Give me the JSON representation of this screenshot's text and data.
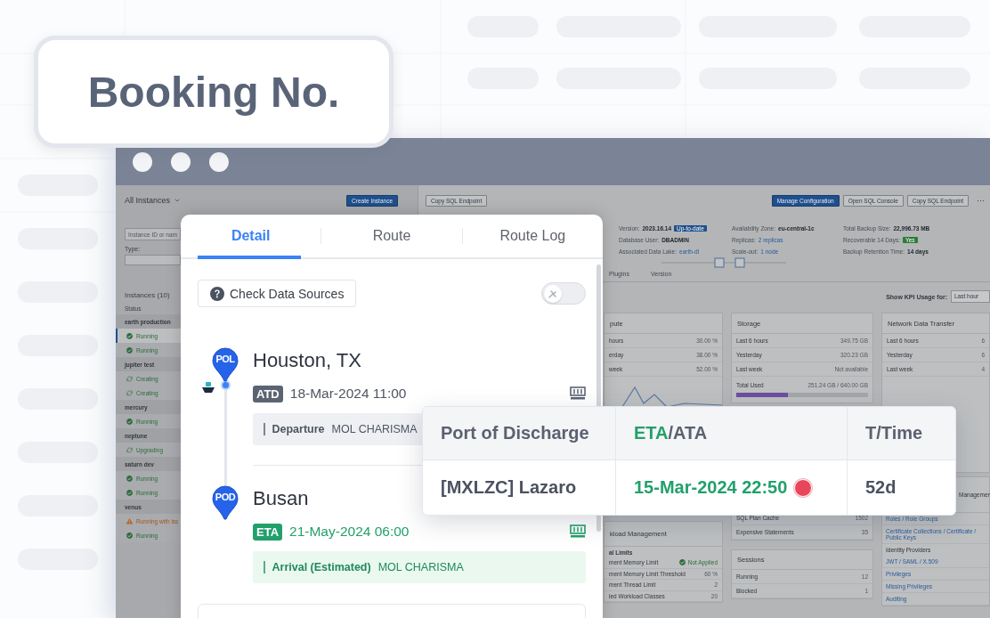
{
  "booking_card": {
    "title": "Booking No."
  },
  "window": {
    "sidebar": {
      "title": "All Instances",
      "create_button": "Create Instance",
      "search_placeholder": "Instance ID or nam",
      "type_label": "Type:",
      "list_title": "Instances (10)",
      "status_label": "Status",
      "groups": [
        {
          "name": "earth production",
          "instances": [
            {
              "status": "Running",
              "kind": "ok",
              "selected": true
            },
            {
              "status": "Running",
              "kind": "ok",
              "selected": false
            }
          ]
        },
        {
          "name": "jupiter test",
          "instances": [
            {
              "status": "Creating",
              "kind": "progress",
              "selected": false
            },
            {
              "status": "Creating",
              "kind": "progress",
              "selected": false
            }
          ]
        },
        {
          "name": "mercury",
          "instances": [
            {
              "status": "Running",
              "kind": "ok",
              "selected": false
            }
          ]
        },
        {
          "name": "neptune",
          "instances": [
            {
              "status": "Upgrading",
              "kind": "progress",
              "selected": false
            }
          ]
        },
        {
          "name": "saturn dev",
          "instances": [
            {
              "status": "Running",
              "kind": "ok",
              "selected": false
            },
            {
              "status": "Running",
              "kind": "ok",
              "selected": false
            }
          ]
        },
        {
          "name": "venus",
          "instances": [
            {
              "status": "Running with iss",
              "kind": "warning",
              "selected": false
            },
            {
              "status": "Running",
              "kind": "ok",
              "selected": false
            }
          ]
        }
      ]
    },
    "toolbar": {
      "left_button": "Copy SQL Endpoint",
      "buttons": [
        {
          "label": "Manage Configuration",
          "primary": true
        },
        {
          "label": "Open SQL Console",
          "primary": false
        },
        {
          "label": "Copy SQL Endpoint",
          "primary": false
        }
      ],
      "more": "···"
    },
    "info": [
      [
        {
          "label": "Version:",
          "value": "2023.16.14",
          "kind": "text",
          "badge": {
            "text": "Up-to-date",
            "color": "#1f4f8c"
          }
        },
        {
          "label": "Database User:",
          "value": "DBADMIN",
          "kind": "text"
        },
        {
          "label": "Associated Data Lake:",
          "value": "earth-dl",
          "kind": "link"
        }
      ],
      [
        {
          "label": "Availability Zone:",
          "value": "eu-central-1c",
          "kind": "text"
        },
        {
          "label": "Replicas:",
          "value": "2 replicas",
          "kind": "link"
        },
        {
          "label": "Scale-out:",
          "value": "1 node",
          "kind": "link"
        }
      ],
      [
        {
          "label": "Total Backup Size:",
          "value": "22,996.73 MB",
          "kind": "text"
        },
        {
          "label": "Recoverable 14 Days:",
          "badge": {
            "text": "Yes",
            "color": "#2f7a3a"
          }
        },
        {
          "label": "Backup Retention Time:",
          "value": "14 days",
          "kind": "text"
        }
      ]
    ],
    "tabs": [
      {
        "label": "Plugins",
        "selected": false
      },
      {
        "label": "Version",
        "selected": false
      }
    ],
    "kpi": {
      "label": "Show KPI Usage for:",
      "value": "Last hour"
    },
    "compute": {
      "title": "pute",
      "rows": [
        {
          "label": "hours",
          "value": "30.00 %"
        },
        {
          "label": "erday",
          "value": "38.00 %"
        },
        {
          "label": "week",
          "value": "52.00 %"
        }
      ]
    },
    "storage": {
      "title": "Storage",
      "rows": [
        {
          "label": "Last 6 hours",
          "value": "349.75 GB"
        },
        {
          "label": "Yesterday",
          "value": "320.23 GB"
        },
        {
          "label": "Last week",
          "value": "Not available"
        }
      ],
      "total": {
        "label": "Total Used",
        "value": "251.24 GB / 640.00 GB",
        "level": 0.39
      }
    },
    "network": {
      "title": "Network Data Transfer",
      "rows": [
        {
          "label": "Last 6 hours",
          "value": "6"
        },
        {
          "label": "Yesterday",
          "value": "6"
        },
        {
          "label": "Last week",
          "value": "4"
        }
      ]
    },
    "workload": {
      "title": "kload Management",
      "section": "al Limits",
      "rows": [
        {
          "label": "ment Memory Limit",
          "value": "Not Applied",
          "kind": "status"
        },
        {
          "label": "ment Memory Limit Threshold",
          "value": "60 %",
          "kind": "text"
        },
        {
          "label": "ment Thread Limit",
          "value": "2",
          "kind": "text"
        },
        {
          "label": "led Workload Classes",
          "value": "20",
          "kind": "text"
        }
      ]
    },
    "statements": {
      "rows": [
        {
          "label": "SQL Plan Cache",
          "value": "1502"
        },
        {
          "label": "Expensive Statements",
          "value": "35"
        }
      ]
    },
    "sessions": {
      "title": "Sessions",
      "rows": [
        {
          "label": "Running",
          "value": "12"
        },
        {
          "label": "Blocked",
          "value": "1"
        }
      ]
    },
    "security": {
      "title": "Managemen",
      "items": [
        {
          "text": "Roles / Role Groups",
          "kind": "link"
        },
        {
          "text": "Certificate Collections / Certificate / Public Keys",
          "kind": "link"
        },
        {
          "text": "Identity Providers",
          "kind": "label"
        },
        {
          "text": "JWT / SAML / X.509",
          "kind": "link"
        },
        {
          "text": "Privileges",
          "kind": "link"
        },
        {
          "text": "Missing Privileges",
          "kind": "link"
        },
        {
          "text": "Auditing",
          "kind": "link"
        }
      ]
    },
    "detail_panel": {
      "tabs": [
        {
          "label": "Detail",
          "selected": true
        },
        {
          "label": "Route",
          "selected": false
        },
        {
          "label": "Route Log",
          "selected": false
        }
      ],
      "check_button": "Check Data Sources",
      "toggle": {
        "on": false
      },
      "stops": [
        {
          "code": "POL",
          "place": "Houston, TX",
          "time_kind": "ATD",
          "time": "18-Mar-2024 11:00",
          "estimated": false,
          "event": "Departure",
          "vessel": "MOL CHARISMA",
          "vessel_here": true
        },
        {
          "code": "POD",
          "place": "Busan",
          "time_kind": "ETA",
          "time": "21-May-2024 06:00",
          "estimated": true,
          "event": "Arrival (Estimated)",
          "vessel": "MOL CHARISMA",
          "vessel_here": false
        }
      ]
    }
  },
  "discharge_popup": {
    "columns": [
      {
        "parts": [
          {
            "text": "Port of Discharge",
            "accent": false
          }
        ]
      },
      {
        "parts": [
          {
            "text": "ETA",
            "accent": true
          },
          {
            "text": "/ATA",
            "accent": false
          }
        ]
      },
      {
        "parts": [
          {
            "text": "T/Time",
            "accent": false
          }
        ]
      }
    ],
    "row": [
      {
        "text": "[MXLZC] Lazaro",
        "accent": false
      },
      {
        "text": "15-Mar-2024 22:50",
        "accent": true,
        "color": "#e8465a"
      },
      {
        "text": "52d",
        "accent": false
      }
    ]
  }
}
